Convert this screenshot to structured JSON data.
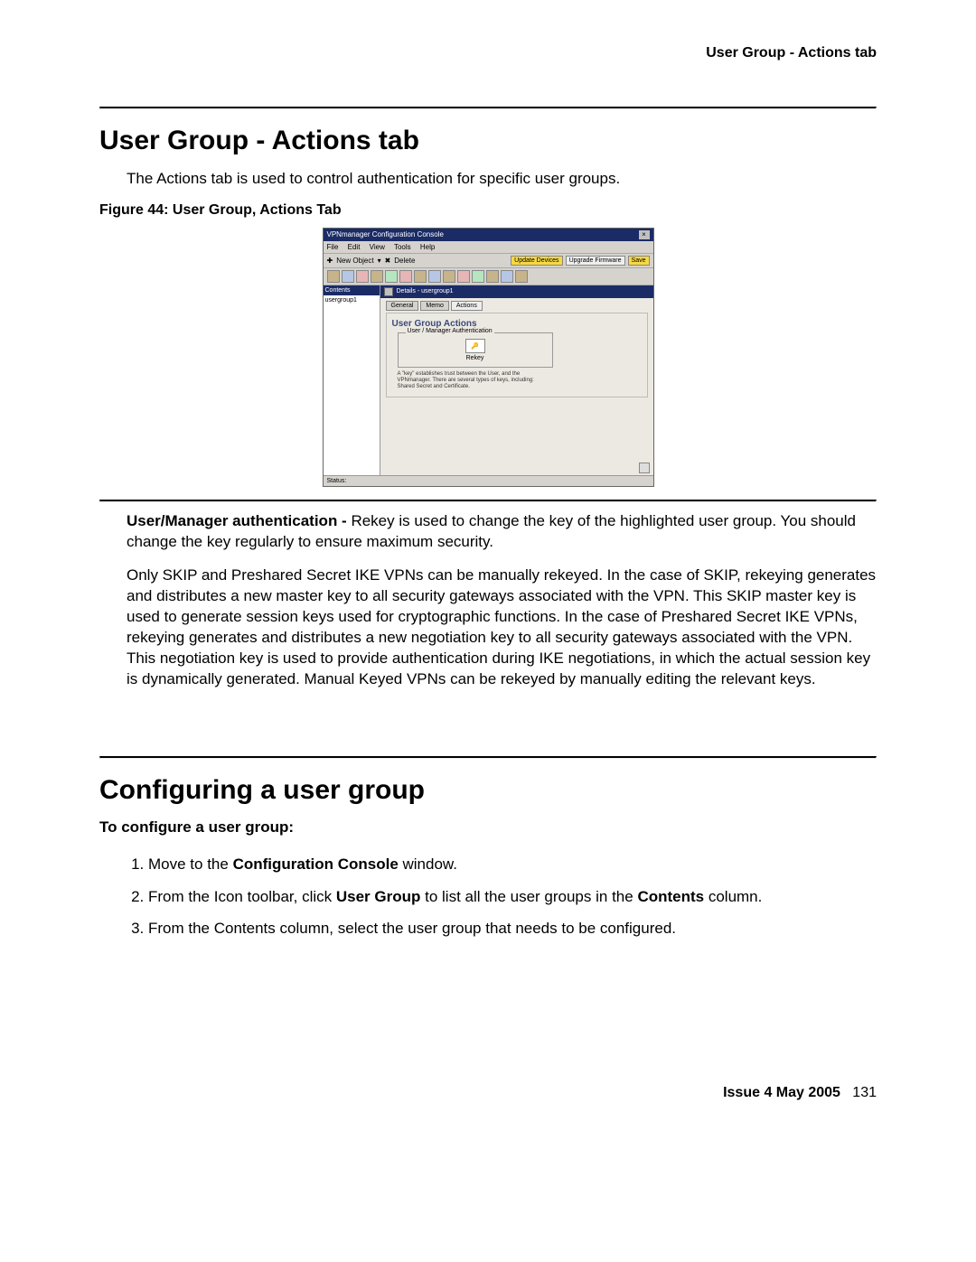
{
  "header": {
    "right": "User Group - Actions tab"
  },
  "section1": {
    "title": "User Group - Actions tab",
    "intro": "The Actions tab is used to control authentication for specific user groups.",
    "figure_caption": "Figure 44: User Group, Actions Tab"
  },
  "mock": {
    "title": "VPNmanager Configuration Console",
    "menu": {
      "file": "File",
      "edit": "Edit",
      "view": "View",
      "tools": "Tools",
      "help": "Help"
    },
    "toolbar": {
      "new_object": "New Object",
      "delete": "Delete",
      "update_devices": "Update Devices",
      "upgrade_firmware": "Upgrade Firmware",
      "save": "Save"
    },
    "left": {
      "header": "Contents",
      "item": "usergroup1"
    },
    "right": {
      "details": "Details - usergroup1",
      "tabs": {
        "general": "General",
        "memo": "Memo",
        "actions": "Actions"
      },
      "panel_title": "User Group Actions",
      "group_legend": "User / Manager Authentication",
      "rekey": "Rekey",
      "desc": "A \"key\" establishes trust between the User, and the VPNmanager. There are several types of keys, including: Shared Secret and Certificate."
    },
    "status": "Status:"
  },
  "post_figure": {
    "p1_bold": "User/Manager authentication - ",
    "p1_rest": "Rekey is used to change the key of the highlighted user group. You should change the key regularly to ensure maximum security.",
    "p2": "Only SKIP and Preshared Secret IKE VPNs can be manually rekeyed. In the case of SKIP, rekeying generates and distributes a new master key to all security gateways associated with the VPN. This SKIP master key is used to generate session keys used for cryptographic functions. In the case of Preshared Secret IKE VPNs, rekeying generates and distributes a new negotiation key to all security gateways associated with the VPN. This negotiation key is used to provide authentication during IKE negotiations, in which the actual session key is dynamically generated. Manual Keyed VPNs can be rekeyed by manually editing the relevant keys."
  },
  "section2": {
    "title": "Configuring a user group",
    "subtitle": "To configure a user group:",
    "steps": {
      "s1_a": "Move to the ",
      "s1_b": "Configuration Console",
      "s1_c": " window.",
      "s2_a": "From the Icon toolbar, click ",
      "s2_b": "User Group",
      "s2_c": " to list all the user groups in the ",
      "s2_d": "Contents",
      "s2_e": " column.",
      "s3": "From the Contents column, select the user group that needs to be configured."
    }
  },
  "footer": {
    "issue": "Issue 4   May 2005",
    "page": "131"
  }
}
